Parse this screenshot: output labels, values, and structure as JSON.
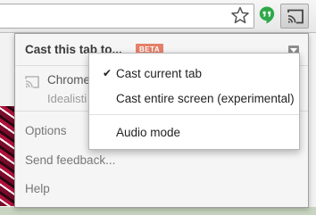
{
  "popup": {
    "title": "Cast this tab to...",
    "beta_badge": "BETA",
    "device": {
      "name": "Chrome",
      "subtitle": "Idealisti"
    },
    "links": {
      "options": "Options",
      "feedback": "Send feedback...",
      "help": "Help"
    }
  },
  "menu": {
    "items": [
      {
        "label": "Cast current tab",
        "checked": true,
        "check_glyph": "✔"
      },
      {
        "label": "Cast entire screen (experimental)",
        "checked": false
      },
      {
        "label": "Audio mode",
        "checked": false
      }
    ]
  },
  "toolbar": {
    "icons": [
      "star-icon",
      "hangouts-icon",
      "cast-icon"
    ]
  },
  "colors": {
    "beta_badge": "#e5806a",
    "popup_bg": "#f5f5f5",
    "hangouts_green": "#2ea84a"
  }
}
